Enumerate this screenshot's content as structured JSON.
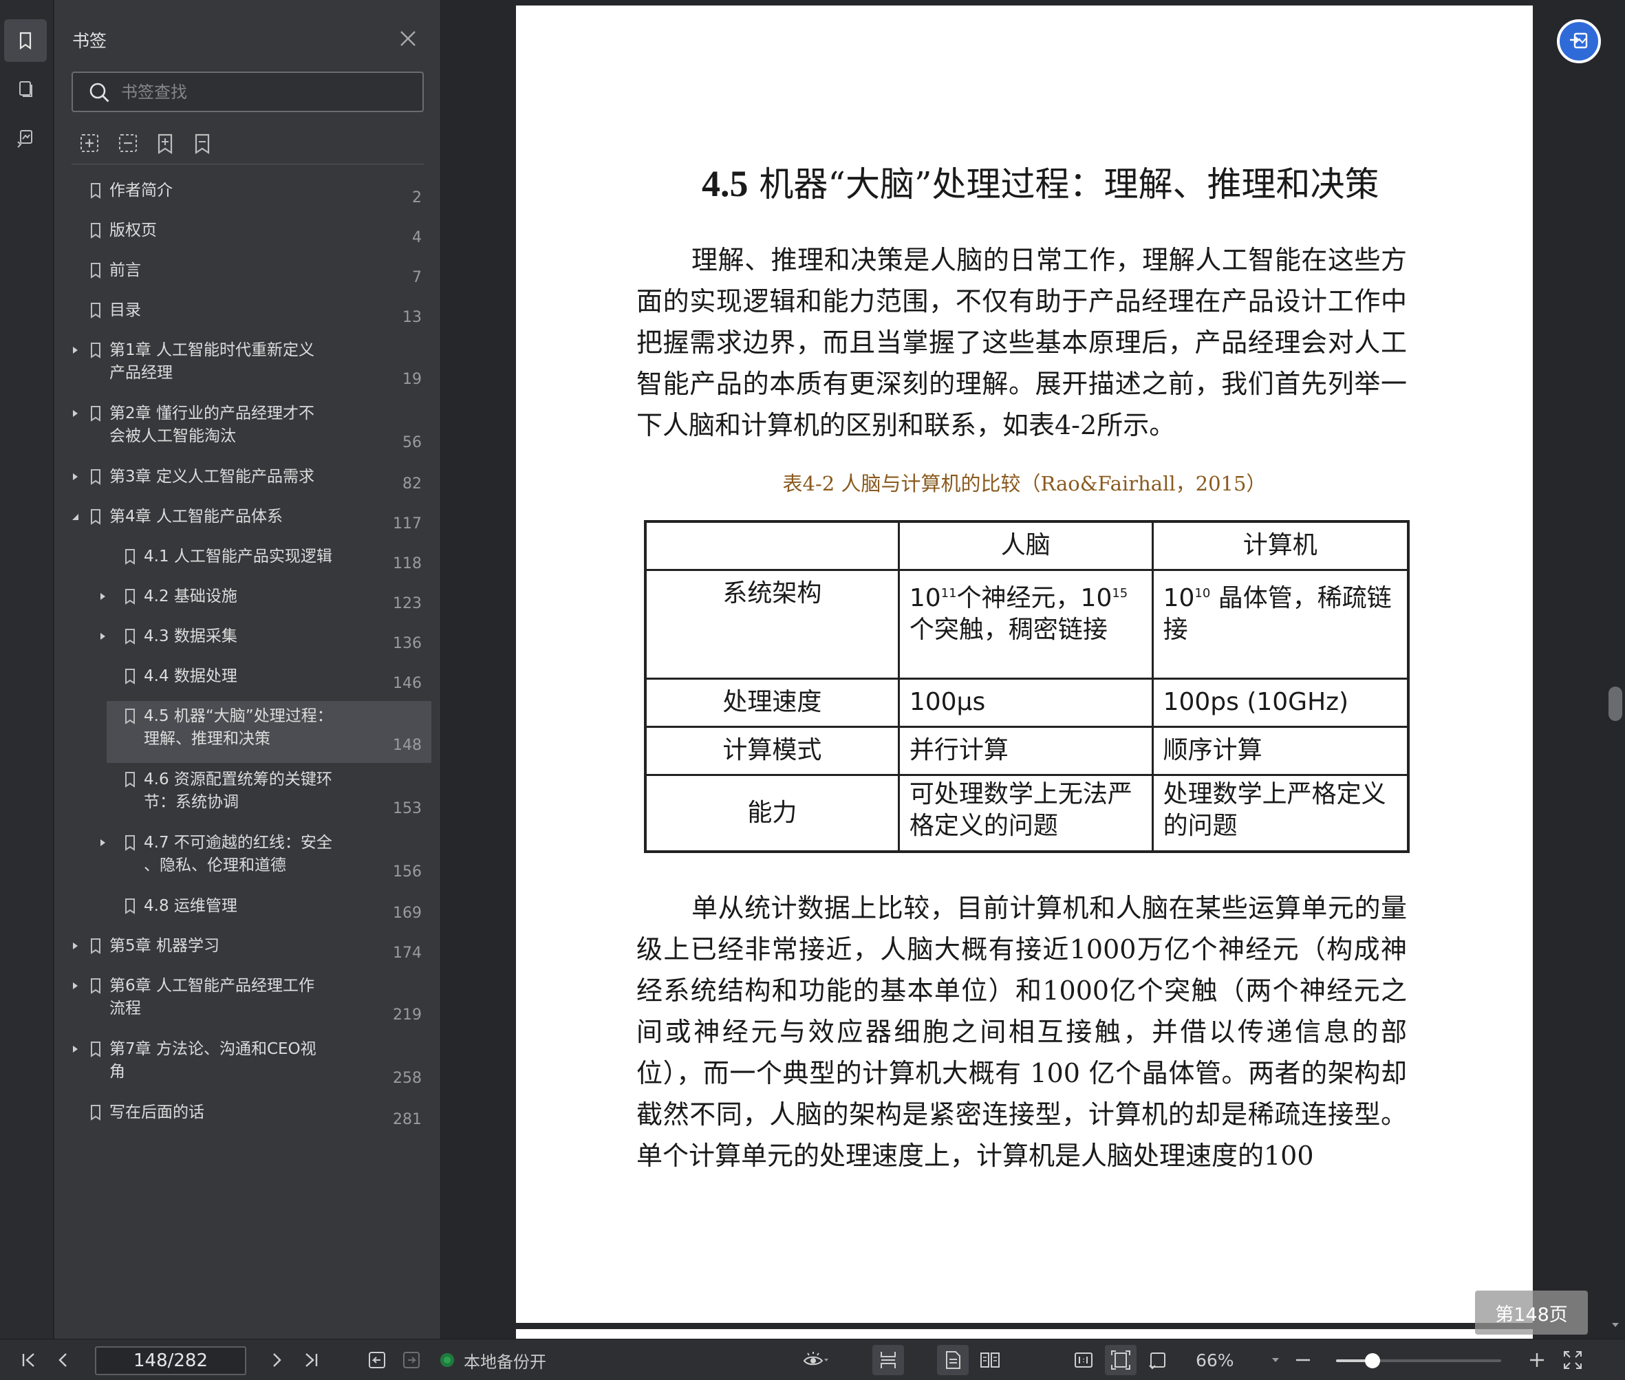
{
  "sidebar": {
    "title": "书签",
    "search_placeholder": "书签查找",
    "bookmarks": [
      {
        "label": "作者简介",
        "page": "2",
        "expand": "none",
        "level": 0
      },
      {
        "label": "版权页",
        "page": "4",
        "expand": "none",
        "level": 0
      },
      {
        "label": "前言",
        "page": "7",
        "expand": "none",
        "level": 0
      },
      {
        "label": "目录",
        "page": "13",
        "expand": "none",
        "level": 0
      },
      {
        "label": "第1章 人工智能时代重新定义\n产品经理",
        "page": "19",
        "expand": "collapsed",
        "level": 0
      },
      {
        "label": "第2章 懂行业的产品经理才不\n会被人工智能淘汰",
        "page": "56",
        "expand": "collapsed",
        "level": 0
      },
      {
        "label": "第3章 定义人工智能产品需求",
        "page": "82",
        "expand": "collapsed",
        "level": 0
      },
      {
        "label": "第4章 人工智能产品体系",
        "page": "117",
        "expand": "expanded",
        "level": 0
      },
      {
        "label": "4.1 人工智能产品实现逻辑",
        "page": "118",
        "expand": "none",
        "level": 1
      },
      {
        "label": "4.2 基础设施",
        "page": "123",
        "expand": "collapsed",
        "level": 1
      },
      {
        "label": "4.3 数据采集",
        "page": "136",
        "expand": "collapsed",
        "level": 1
      },
      {
        "label": "4.4 数据处理",
        "page": "146",
        "expand": "none",
        "level": 1
      },
      {
        "label": "4.5 机器“大脑”处理过程：\n理解、推理和决策",
        "page": "148",
        "expand": "none",
        "level": 1,
        "selected": true
      },
      {
        "label": "4.6 资源配置统筹的关键环\n节：系统协调",
        "page": "153",
        "expand": "none",
        "level": 1
      },
      {
        "label": "4.7 不可逾越的红线：安全\n、隐私、伦理和道德",
        "page": "156",
        "expand": "collapsed",
        "level": 1
      },
      {
        "label": "4.8 运维管理",
        "page": "169",
        "expand": "none",
        "level": 1
      },
      {
        "label": "第5章 机器学习",
        "page": "174",
        "expand": "collapsed",
        "level": 0
      },
      {
        "label": "第6章 人工智能产品经理工作\n流程",
        "page": "219",
        "expand": "collapsed",
        "level": 0
      },
      {
        "label": "第7章 方法论、沟通和CEO视\n角",
        "page": "258",
        "expand": "collapsed",
        "level": 0
      },
      {
        "label": "写在后面的话",
        "page": "281",
        "expand": "none",
        "level": 0
      }
    ]
  },
  "document": {
    "section_number": "4.5",
    "section_title": "机器“大脑”处理过程：理解、推理和决策",
    "para1": "理解、推理和决策是人脑的日常工作，理解人工智能在这些方面的实现逻辑和能力范围，不仅有助于产品经理在产品设计工作中把握需求边界，而且当掌握了这些基本原理后，产品经理会对人工智能产品的本质有更深刻的理解。展开描述之前，我们首先列举一下人脑和计算机的区别和联系，如表4-2所示。",
    "table_caption": "表4-2 人脑与计算机的比较（Rao&Fairhall，2015）",
    "table": {
      "headers": [
        "",
        "人脑",
        "计算机"
      ],
      "rows": [
        {
          "label": "系统架构",
          "brain_pre": "10",
          "brain_sup1": "11",
          "brain_mid": "个神经元，10",
          "brain_sup2": "15",
          "brain_post": "个突触，稠密链接",
          "comp_pre": "10",
          "comp_sup": "10",
          "comp_post": " 晶体管，稀疏链接"
        },
        {
          "label": "处理速度",
          "brain": "100μs",
          "computer": "100ps (10GHz)"
        },
        {
          "label": "计算模式",
          "brain": "并行计算",
          "computer": "顺序计算"
        },
        {
          "label": "能力",
          "brain": "可处理数学上无法严格定义的问题",
          "computer": "处理数学上严格定义的问题"
        }
      ]
    },
    "para2": "单从统计数据上比较，目前计算机和人脑在某些运算单元的量级上已经非常接近，人脑大概有接近1000万亿个神经元（构成神经系统结构和功能的基本单位）和1000亿个突触（两个神经元之间或神经元与效应器细胞之间相互接触，并借以传递信息的部位），而一个典型的计算机大概有 100 亿个晶体管。两者的架构却截然不同，人脑的架构是紧密连接型，计算机的却是稀疏连接型。单个计算单元的处理速度上，计算机是人脑处理速度的100"
  },
  "page_badge": "第148页",
  "status": {
    "page_field": "148/282",
    "backup_label": "本地备份开",
    "zoom_label": "66%",
    "zoom_fraction": 0.22
  },
  "colors": {
    "accent": "#2f6bd8",
    "backup_dot": "#2d9f52",
    "caption": "#8a5a1e"
  }
}
